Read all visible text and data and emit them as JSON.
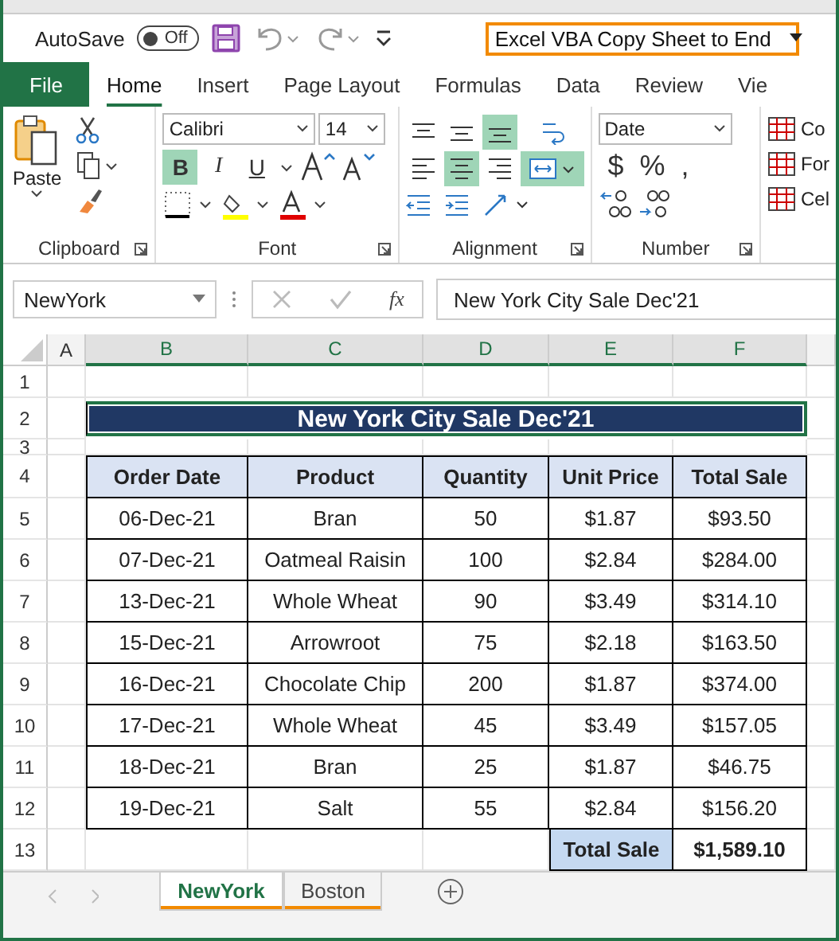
{
  "quick_access": {
    "autosave_label": "AutoSave",
    "autosave_toggle": {
      "label": "Off",
      "on": false
    },
    "document_title": "Excel VBA Copy Sheet to End"
  },
  "ribbon_tabs": [
    {
      "label": "File",
      "kind": "file",
      "selected": false
    },
    {
      "label": "Home",
      "kind": "tab",
      "selected": true
    },
    {
      "label": "Insert",
      "kind": "tab",
      "selected": false
    },
    {
      "label": "Page Layout",
      "kind": "tab",
      "selected": false
    },
    {
      "label": "Formulas",
      "kind": "tab",
      "selected": false
    },
    {
      "label": "Data",
      "kind": "tab",
      "selected": false
    },
    {
      "label": "Review",
      "kind": "tab",
      "selected": false
    },
    {
      "label": "Vie",
      "kind": "tab",
      "selected": false
    }
  ],
  "ribbon": {
    "clipboard": {
      "label": "Clipboard",
      "paste_label": "Paste"
    },
    "font": {
      "label": "Font",
      "font_name": "Calibri",
      "font_size": "14",
      "style_buttons": [
        {
          "text": "B",
          "kind": "bold",
          "selected": true
        },
        {
          "text": "I",
          "kind": "italic",
          "selected": false
        },
        {
          "text": "U",
          "kind": "underline",
          "selected": false
        }
      ]
    },
    "alignment": {
      "label": "Alignment",
      "buttons": [
        {
          "kind": "align-top",
          "selected": false
        },
        {
          "kind": "align-middle",
          "selected": false
        },
        {
          "kind": "align-bottom",
          "selected": true
        },
        {
          "kind": "wrap",
          "selected": false
        },
        {
          "kind": "align-left",
          "selected": false
        },
        {
          "kind": "align-center",
          "selected": true
        },
        {
          "kind": "align-right",
          "selected": false
        },
        {
          "kind": "merge",
          "selected": true
        }
      ]
    },
    "number": {
      "label": "Number",
      "format": "Date",
      "symbols": [
        "$",
        "%",
        ","
      ]
    },
    "styles": {
      "items": [
        "Co",
        "For",
        "Cel"
      ]
    }
  },
  "formula_bar": {
    "name_box": "NewYork",
    "function_label": "fx",
    "formula": "New York City Sale Dec'21"
  },
  "sheet": {
    "columns": [
      "A",
      "B",
      "C",
      "D",
      "E",
      "F"
    ],
    "rows": [
      "1",
      "2",
      "3",
      "4",
      "5",
      "6",
      "7",
      "8",
      "9",
      "10",
      "11",
      "12",
      "13"
    ],
    "title": "New York City Sale Dec'21",
    "headers": [
      "Order Date",
      "Product",
      "Quantity",
      "Unit Price",
      "Total Sale"
    ],
    "data": [
      [
        "06-Dec-21",
        "Bran",
        "50",
        "$1.87",
        "$93.50"
      ],
      [
        "07-Dec-21",
        "Oatmeal Raisin",
        "100",
        "$2.84",
        "$284.00"
      ],
      [
        "13-Dec-21",
        "Whole Wheat",
        "90",
        "$3.49",
        "$314.10"
      ],
      [
        "15-Dec-21",
        "Arrowroot",
        "75",
        "$2.18",
        "$163.50"
      ],
      [
        "16-Dec-21",
        "Chocolate Chip",
        "200",
        "$1.87",
        "$374.00"
      ],
      [
        "17-Dec-21",
        "Whole Wheat",
        "45",
        "$3.49",
        "$157.05"
      ],
      [
        "18-Dec-21",
        "Bran",
        "25",
        "$1.87",
        "$46.75"
      ],
      [
        "19-Dec-21",
        "Salt",
        "55",
        "$2.84",
        "$156.20"
      ]
    ],
    "total_label": "Total Sale",
    "total_value": "$1,589.10"
  },
  "sheet_tabs": [
    {
      "label": "NewYork",
      "selected": true
    },
    {
      "label": "Boston",
      "selected": false
    }
  ]
}
